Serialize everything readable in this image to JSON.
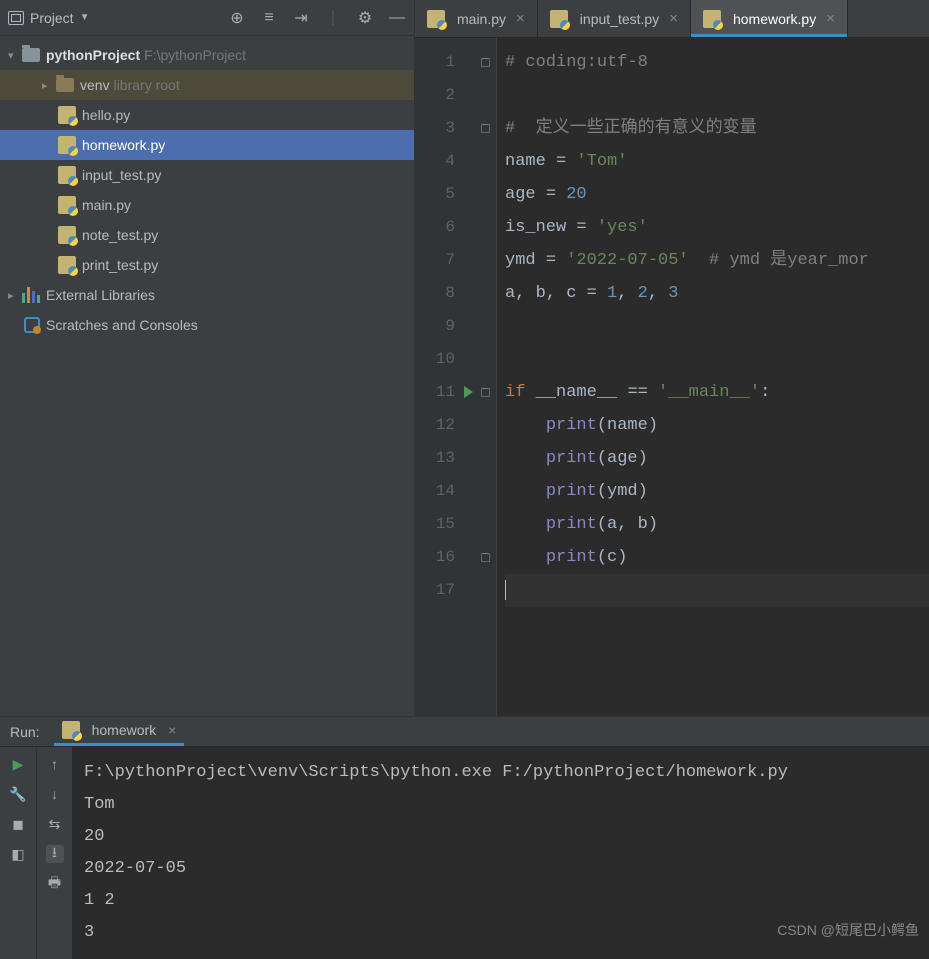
{
  "sidebar": {
    "title": "Project",
    "root": {
      "name": "pythonProject",
      "path": "F:\\pythonProject"
    },
    "venv": {
      "name": "venv",
      "hint": "library root"
    },
    "files": [
      "hello.py",
      "homework.py",
      "input_test.py",
      "main.py",
      "note_test.py",
      "print_test.py"
    ],
    "selected": "homework.py",
    "external": "External Libraries",
    "scratches": "Scratches and Consoles"
  },
  "tabs": [
    {
      "label": "main.py",
      "active": false
    },
    {
      "label": "input_test.py",
      "active": false
    },
    {
      "label": "homework.py",
      "active": true
    }
  ],
  "code_lines": [
    {
      "n": 1,
      "fold": true,
      "tokens": [
        {
          "t": "# coding:utf-8",
          "c": "c-comment"
        }
      ]
    },
    {
      "n": 2,
      "tokens": []
    },
    {
      "n": 3,
      "fold": true,
      "tokens": [
        {
          "t": "#  定义一些正确的有意义的变量",
          "c": "c-comment"
        }
      ]
    },
    {
      "n": 4,
      "tokens": [
        {
          "t": "name ",
          "c": "c-id"
        },
        {
          "t": "= ",
          "c": "c-op"
        },
        {
          "t": "'Tom'",
          "c": "c-str"
        }
      ]
    },
    {
      "n": 5,
      "tokens": [
        {
          "t": "age ",
          "c": "c-id"
        },
        {
          "t": "= ",
          "c": "c-op"
        },
        {
          "t": "20",
          "c": "c-num"
        }
      ]
    },
    {
      "n": 6,
      "tokens": [
        {
          "t": "is_new ",
          "c": "c-id"
        },
        {
          "t": "= ",
          "c": "c-op"
        },
        {
          "t": "'yes'",
          "c": "c-str"
        }
      ]
    },
    {
      "n": 7,
      "tokens": [
        {
          "t": "ymd ",
          "c": "c-id"
        },
        {
          "t": "= ",
          "c": "c-op"
        },
        {
          "t": "'2022-07-05'",
          "c": "c-str"
        },
        {
          "t": "  # ymd 是year_mor",
          "c": "c-comment"
        }
      ]
    },
    {
      "n": 8,
      "tokens": [
        {
          "t": "a",
          "c": "c-id"
        },
        {
          "t": ", ",
          "c": "c-op"
        },
        {
          "t": "b",
          "c": "c-id"
        },
        {
          "t": ", ",
          "c": "c-op"
        },
        {
          "t": "c ",
          "c": "c-id"
        },
        {
          "t": "= ",
          "c": "c-op"
        },
        {
          "t": "1",
          "c": "c-num"
        },
        {
          "t": ", ",
          "c": "c-op"
        },
        {
          "t": "2",
          "c": "c-num"
        },
        {
          "t": ", ",
          "c": "c-op"
        },
        {
          "t": "3",
          "c": "c-num"
        }
      ]
    },
    {
      "n": 9,
      "tokens": []
    },
    {
      "n": 10,
      "tokens": []
    },
    {
      "n": 11,
      "fold": true,
      "play": true,
      "tokens": [
        {
          "t": "if ",
          "c": "c-kw"
        },
        {
          "t": "__name__ ",
          "c": "c-id"
        },
        {
          "t": "== ",
          "c": "c-op"
        },
        {
          "t": "'__main__'",
          "c": "c-str"
        },
        {
          "t": ":",
          "c": "c-op"
        }
      ]
    },
    {
      "n": 12,
      "tokens": [
        {
          "t": "    ",
          "c": ""
        },
        {
          "t": "print",
          "c": "c-builtin"
        },
        {
          "t": "(name)",
          "c": "c-op"
        }
      ]
    },
    {
      "n": 13,
      "tokens": [
        {
          "t": "    ",
          "c": ""
        },
        {
          "t": "print",
          "c": "c-builtin"
        },
        {
          "t": "(age)",
          "c": "c-op"
        }
      ]
    },
    {
      "n": 14,
      "tokens": [
        {
          "t": "    ",
          "c": ""
        },
        {
          "t": "print",
          "c": "c-builtin"
        },
        {
          "t": "(ymd)",
          "c": "c-op"
        }
      ]
    },
    {
      "n": 15,
      "tokens": [
        {
          "t": "    ",
          "c": ""
        },
        {
          "t": "print",
          "c": "c-builtin"
        },
        {
          "t": "(a",
          "c": "c-op"
        },
        {
          "t": ", ",
          "c": "c-op"
        },
        {
          "t": "b)",
          "c": "c-op"
        }
      ]
    },
    {
      "n": 16,
      "fold": true,
      "tokens": [
        {
          "t": "    ",
          "c": ""
        },
        {
          "t": "print",
          "c": "c-builtin"
        },
        {
          "t": "(c)",
          "c": "c-op"
        }
      ]
    },
    {
      "n": 17,
      "current": true,
      "tokens": []
    }
  ],
  "run": {
    "label": "Run:",
    "tab": "homework",
    "output": [
      "F:\\pythonProject\\venv\\Scripts\\python.exe F:/pythonProject/homework.py",
      "Tom",
      "20",
      "2022-07-05",
      "1 2",
      "3"
    ]
  },
  "watermark": "CSDN @短尾巴小鳄鱼"
}
